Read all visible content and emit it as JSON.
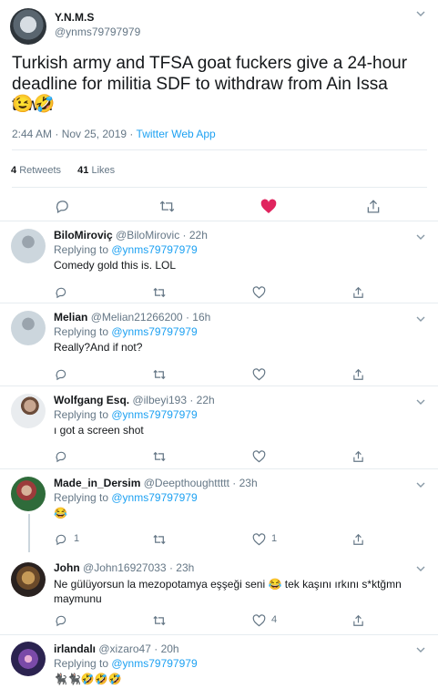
{
  "main_tweet": {
    "display_name": "Y.N.M.S",
    "handle": "@ynms79797979",
    "text": "Turkish army and TFSA goat fuckers give a 24-hour deadline for militia SDF to withdraw from Ain Issa town.",
    "emojis": "😉🤣",
    "time": "2:44 AM · Nov 25, 2019 · ",
    "source": "Twitter Web App",
    "retweets_count": "4",
    "retweets_label": "Retweets",
    "likes_count": "41",
    "likes_label": "Likes",
    "liked": true,
    "like_color": "#e0245e"
  },
  "replying_label": "Replying to ",
  "mention": "@ynms79797979",
  "replies": [
    {
      "name": "BiloMiroviç",
      "handle": "@BiloMirovic · 22h",
      "text": "Comedy gold this is. LOL",
      "reply_count": "",
      "like_count": ""
    },
    {
      "name": "Melian",
      "handle": "@Melian21266200 · 16h",
      "text": "Really?And if not?",
      "reply_count": "",
      "like_count": ""
    },
    {
      "name": "Wolfgang Esq.",
      "handle": "@ilbeyi193 · 22h",
      "text": "ı got a screen shot",
      "reply_count": "",
      "like_count": ""
    },
    {
      "name": "Made_in_Dersim",
      "handle": "@Deepthoughttttt · 23h",
      "text": "😂",
      "reply_count": "1",
      "like_count": "1"
    },
    {
      "name": "John",
      "handle": "@John16927033 · 23h",
      "text": "Ne gülüyorsun la mezopotamya eşşeği seni 😂 tek kaşını ırkını s*ktğmn maymunu",
      "reply_count": "",
      "like_count": "4"
    },
    {
      "name": "irlandalı",
      "handle": "@xizaro47 · 20h",
      "text": "🐈‍⬛🐈‍⬛🤣🤣🤣",
      "reply_count": "",
      "like_count": ""
    }
  ],
  "colors": {
    "accent": "#1da1f2",
    "muted": "#657786",
    "icon": "#657786",
    "border": "#e6ecf0"
  },
  "icons": [
    "reply-icon",
    "retweet-icon",
    "like-icon",
    "share-icon",
    "chevron-down-icon"
  ]
}
